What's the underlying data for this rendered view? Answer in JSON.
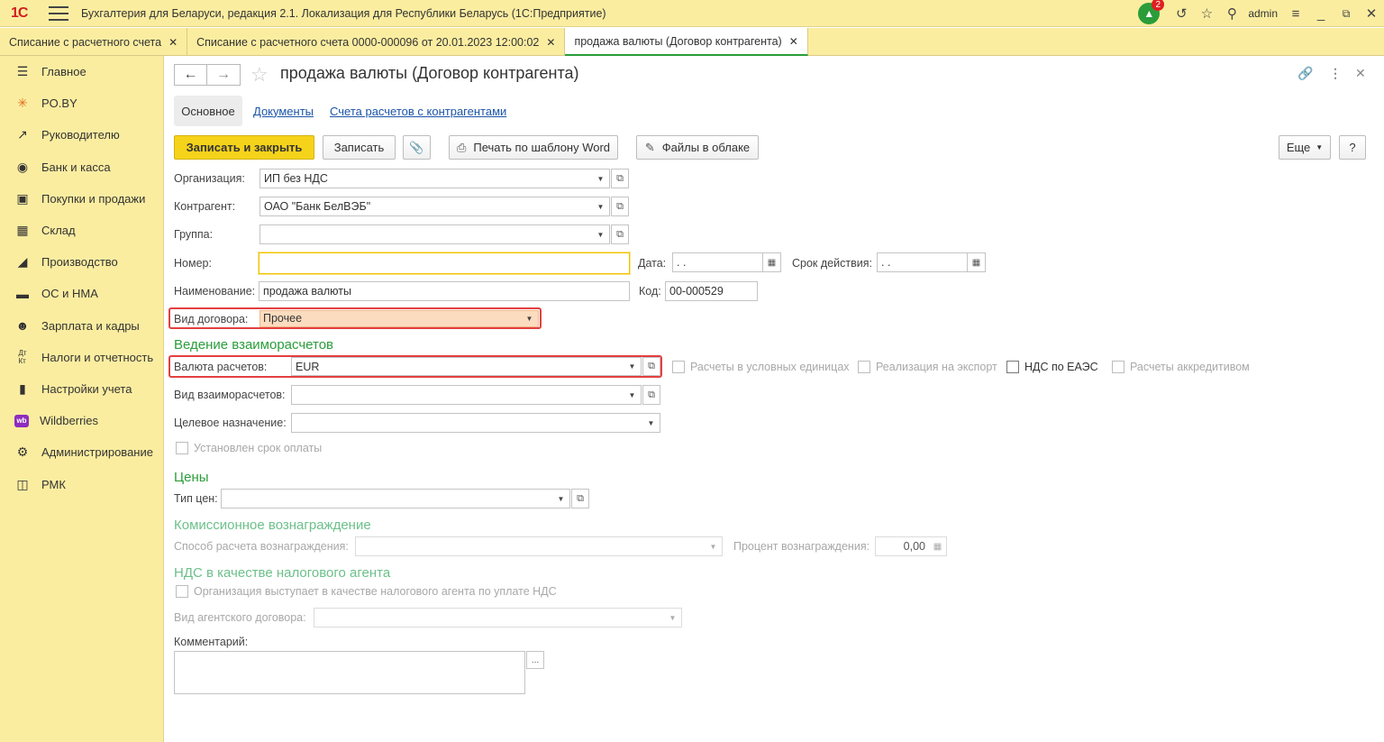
{
  "app": {
    "logo": "1C",
    "title": "Бухгалтерия для Беларуси, редакция 2.1. Локализация для Республики Беларусь  (1С:Предприятие)",
    "notifications_count": "2",
    "user": "admin"
  },
  "tabs": [
    {
      "label": "Списание с расчетного счета"
    },
    {
      "label": "Списание с расчетного счета 0000-000096 от 20.01.2023 12:00:02"
    },
    {
      "label": "продажа валюты (Договор контрагента)"
    }
  ],
  "sidebar": {
    "items": [
      {
        "label": "Главное",
        "icon": "menu-lines-icon"
      },
      {
        "label": "PO.BY",
        "icon": "sun-icon"
      },
      {
        "label": "Руководителю",
        "icon": "trend-icon"
      },
      {
        "label": "Банк и касса",
        "icon": "coin-icon"
      },
      {
        "label": "Покупки и продажи",
        "icon": "cart-icon"
      },
      {
        "label": "Склад",
        "icon": "warehouse-icon"
      },
      {
        "label": "Производство",
        "icon": "factory-icon"
      },
      {
        "label": "ОС и НМА",
        "icon": "truck-icon"
      },
      {
        "label": "Зарплата и кадры",
        "icon": "person-icon"
      },
      {
        "label": "Налоги и отчетность",
        "icon": "dt-kt-icon"
      },
      {
        "label": "Настройки учета",
        "icon": "book-icon"
      },
      {
        "label": "Wildberries",
        "icon": "wb-icon"
      },
      {
        "label": "Администрирование",
        "icon": "gear-icon"
      },
      {
        "label": "РМК",
        "icon": "register-icon"
      }
    ]
  },
  "form": {
    "title": "продажа валюты (Договор контрагента)",
    "tabs": {
      "main": "Основное",
      "documents": "Документы",
      "accounts": "Счета расчетов с контрагентами"
    },
    "toolbar": {
      "save_close": "Записать и закрыть",
      "save": "Записать",
      "print_word": "Печать по шаблону Word",
      "cloud_files": "Файлы в облаке",
      "more": "Еще",
      "help": "?"
    },
    "fields": {
      "organization": {
        "label": "Организация:",
        "value": "ИП без НДС"
      },
      "counterparty": {
        "label": "Контрагент:",
        "value": "ОАО \"Банк БелВЭБ\""
      },
      "group": {
        "label": "Группа:",
        "value": ""
      },
      "number": {
        "label": "Номер:",
        "value": ""
      },
      "date": {
        "label": "Дата:",
        "value": " .  ."
      },
      "validity": {
        "label": "Срок действия:",
        "value": " .  ."
      },
      "name": {
        "label": "Наименование:",
        "value": "продажа валюты"
      },
      "code": {
        "label": "Код:",
        "value": "00-000529"
      },
      "contract_type": {
        "label": "Вид договора:",
        "value": "Прочее"
      }
    },
    "settlements": {
      "heading": "Ведение взаиморасчетов",
      "currency": {
        "label": "Валюта расчетов:",
        "value": "EUR"
      },
      "conventional_units": "Расчеты в условных единицах",
      "export": "Реализация на экспорт",
      "vat_eaeu": "НДС по ЕАЭС",
      "letter_of_credit": "Расчеты аккредитивом",
      "settlement_type": {
        "label": "Вид взаиморасчетов:",
        "value": ""
      },
      "purpose": {
        "label": "Целевое назначение:",
        "value": ""
      },
      "payment_term": "Установлен срок оплаты"
    },
    "prices": {
      "heading": "Цены",
      "price_type": {
        "label": "Тип цен:",
        "value": ""
      }
    },
    "commission": {
      "heading": "Комиссионное вознаграждение",
      "method": {
        "label": "Способ расчета вознаграждения:",
        "value": ""
      },
      "percent": {
        "label": "Процент вознаграждения:",
        "value": "0,00"
      }
    },
    "vat_agent": {
      "heading": "НДС в качестве налогового агента",
      "checkbox": "Организация выступает в качестве налогового агента по уплате НДС",
      "agent_contract": {
        "label": "Вид агентского договора:",
        "value": ""
      }
    },
    "comment": {
      "label": "Комментарий:",
      "value": ""
    }
  },
  "colors": {
    "accent": "#2a9d3a",
    "panel": "#fbeda0",
    "primary_button": "#f5d31b",
    "highlight": "#e34040"
  }
}
